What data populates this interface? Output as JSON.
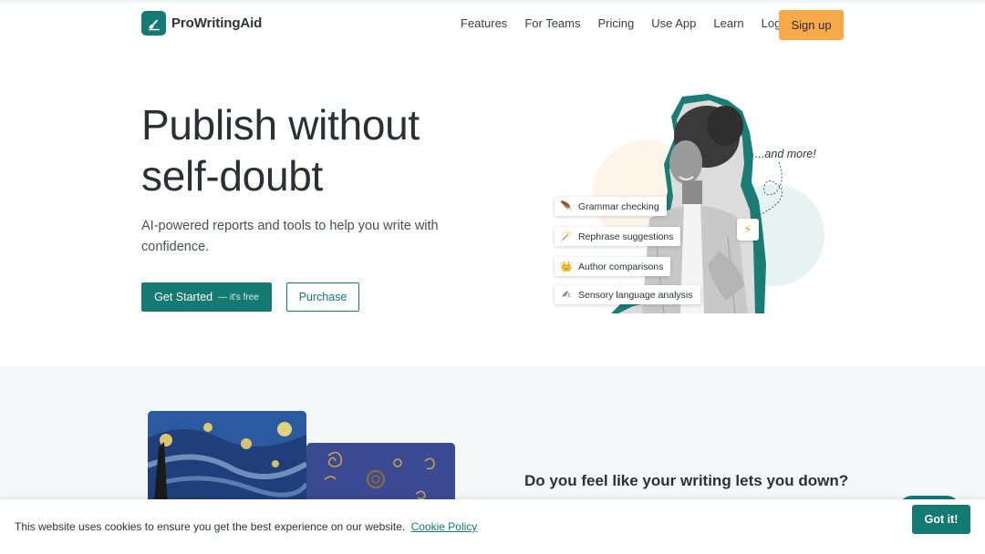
{
  "nav": {
    "brand": "ProWritingAid",
    "links": [
      "Features",
      "For Teams",
      "Pricing",
      "Use App",
      "Learn",
      "Log in"
    ],
    "signup_label": "Sign up"
  },
  "hero": {
    "title": "Publish without self-doubt",
    "subtitle": "AI-powered reports and tools to help you write with confidence.",
    "primary_button": "Get Started",
    "primary_button_note": "— it's free",
    "secondary_button": "Purchase",
    "badges": [
      {
        "icon": "quill-icon",
        "label": "Grammar checking"
      },
      {
        "icon": "magic-wand-icon",
        "label": "Rephrase suggestions"
      },
      {
        "icon": "crown-icon",
        "label": "Author comparisons"
      },
      {
        "icon": "writing-hand-icon",
        "label": "Sensory language analysis"
      }
    ],
    "and_more": "...and more!"
  },
  "section2": {
    "heading": "Do you feel like your writing lets you down?"
  },
  "cookie": {
    "text": "This website uses cookies to ensure you get the best experience on our website.",
    "link": "Cookie Policy",
    "button": "Got it!"
  },
  "colors": {
    "brand_teal": "#157a72",
    "signup_orange": "#f8a949",
    "section_bg": "#f4f8f9"
  }
}
